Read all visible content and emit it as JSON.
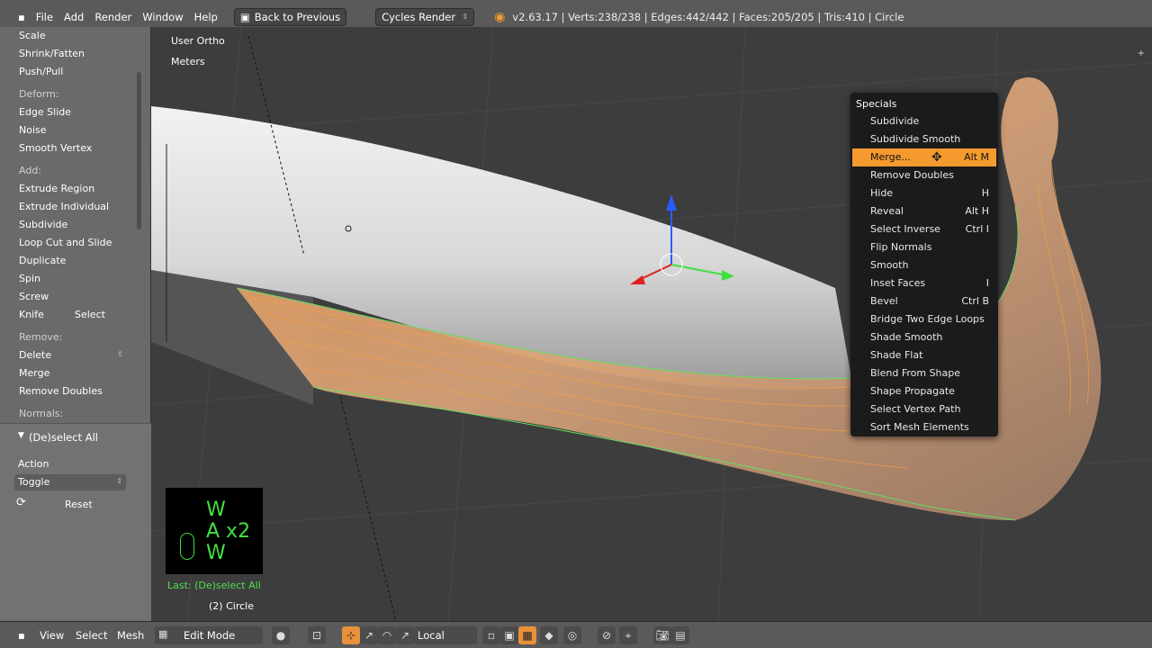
{
  "topbar": {
    "menus": [
      "File",
      "Add",
      "Render",
      "Window",
      "Help"
    ],
    "back_button": "Back to Previous",
    "engine": "Cycles Render",
    "stats": "v2.63.17 | Verts:238/238 | Edges:442/442 | Faces:205/205 | Tris:410 | Circle"
  },
  "toolshelf": {
    "transform_items": [
      "Scale",
      "Shrink/Fatten",
      "Push/Pull"
    ],
    "deform_header": "Deform:",
    "deform_items": [
      "Edge Slide",
      "Noise",
      "Smooth Vertex"
    ],
    "add_header": "Add:",
    "add_items": [
      "Extrude Region",
      "Extrude Individual",
      "Subdivide",
      "Loop Cut and Slide",
      "Duplicate",
      "Spin",
      "Screw"
    ],
    "knife": "Knife",
    "select": "Select",
    "remove_header": "Remove:",
    "delete": "Delete",
    "merge": "Merge",
    "remove_doubles": "Remove Doubles",
    "normals_header": "Normals:",
    "operator_panel": "(De)select All",
    "action_label": "Action",
    "action_value": "Toggle",
    "reset": "Reset"
  },
  "viewport": {
    "view_name": "User Ortho",
    "units": "Meters",
    "last_op": "Last: (De)select All",
    "object_info": "(2) Circle"
  },
  "keys": {
    "line1": "W",
    "line2": "A x2",
    "line3": "W"
  },
  "specials": {
    "title": "Specials",
    "items": [
      {
        "label": "Subdivide",
        "shortcut": ""
      },
      {
        "label": "Subdivide Smooth",
        "shortcut": ""
      },
      {
        "label": "Merge...",
        "shortcut": "Alt M"
      },
      {
        "label": "Remove Doubles",
        "shortcut": ""
      },
      {
        "label": "Hide",
        "shortcut": "H"
      },
      {
        "label": "Reveal",
        "shortcut": "Alt H"
      },
      {
        "label": "Select Inverse",
        "shortcut": "Ctrl I"
      },
      {
        "label": "Flip Normals",
        "shortcut": ""
      },
      {
        "label": "Smooth",
        "shortcut": ""
      },
      {
        "label": "Inset Faces",
        "shortcut": "I"
      },
      {
        "label": "Bevel",
        "shortcut": "Ctrl B"
      },
      {
        "label": "Bridge Two Edge Loops",
        "shortcut": ""
      },
      {
        "label": "Shade Smooth",
        "shortcut": ""
      },
      {
        "label": "Shade Flat",
        "shortcut": ""
      },
      {
        "label": "Blend From Shape",
        "shortcut": ""
      },
      {
        "label": "Shape Propagate",
        "shortcut": ""
      },
      {
        "label": "Select Vertex Path",
        "shortcut": ""
      },
      {
        "label": "Sort Mesh Elements",
        "shortcut": ""
      }
    ]
  },
  "bottombar": {
    "view": "View",
    "select": "Select",
    "mesh": "Mesh",
    "mode": "Edit Mode",
    "pivot": "Local"
  },
  "colors": {
    "highlight": "#f49a2e",
    "selection": "#f08a2a",
    "key_overlay": "#43e043"
  }
}
